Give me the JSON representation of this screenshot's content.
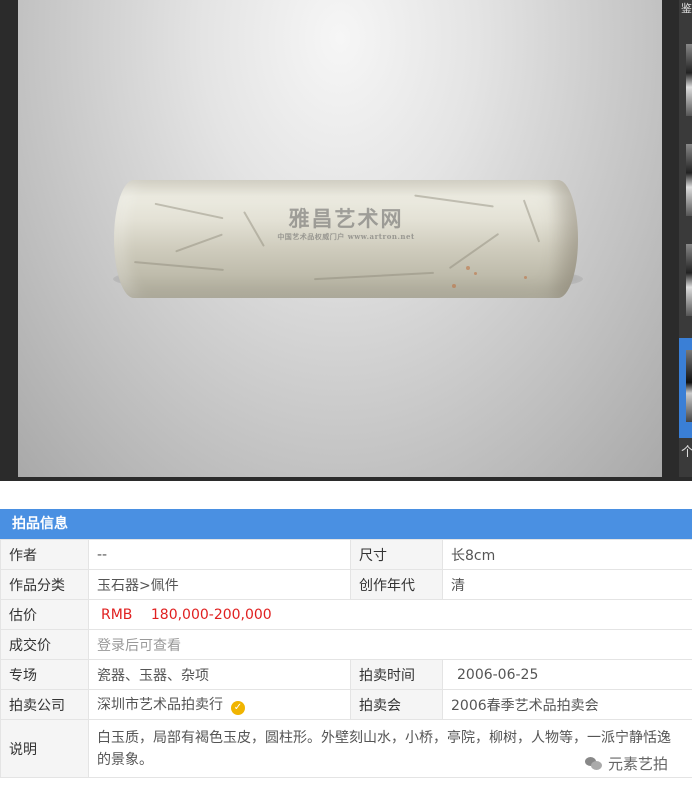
{
  "viewer": {
    "watermark_main": "雅昌艺术网",
    "watermark_sub": "中国艺术品权威门户 www.artron.net",
    "thumb_label": "鉴",
    "thumb_last": "个"
  },
  "lot_info": {
    "section_title": "拍品信息",
    "rows": {
      "author_label": "作者",
      "author_value": "--",
      "size_label": "尺寸",
      "size_value": "长8cm",
      "category_label": "作品分类",
      "category_value": "玉石器>佩件",
      "era_label": "创作年代",
      "era_value": "清",
      "estimate_label": "估价",
      "estimate_currency": "RMB",
      "estimate_value": "180,000-200,000",
      "deal_label": "成交价",
      "deal_value": "登录后可查看",
      "session_label": "专场",
      "session_value": "瓷器、玉器、杂项",
      "date_label": "拍卖时间",
      "date_value": "2006-06-25",
      "house_label": "拍卖公司",
      "house_value": "深圳市艺术品拍卖行",
      "auction_label": "拍卖会",
      "auction_value": "2006春季艺术品拍卖会",
      "desc_label": "说明",
      "desc_value": "白玉质，局部有褐色玉皮，圆柱形。外壁刻山水，小桥，亭院，柳树，人物等，一派宁静恬逸的景象。"
    }
  },
  "brand": {
    "name": "元素艺拍"
  },
  "colors": {
    "header_blue": "#4a90e2",
    "price_red": "#e02020",
    "label_bg": "#f5f5f5"
  }
}
